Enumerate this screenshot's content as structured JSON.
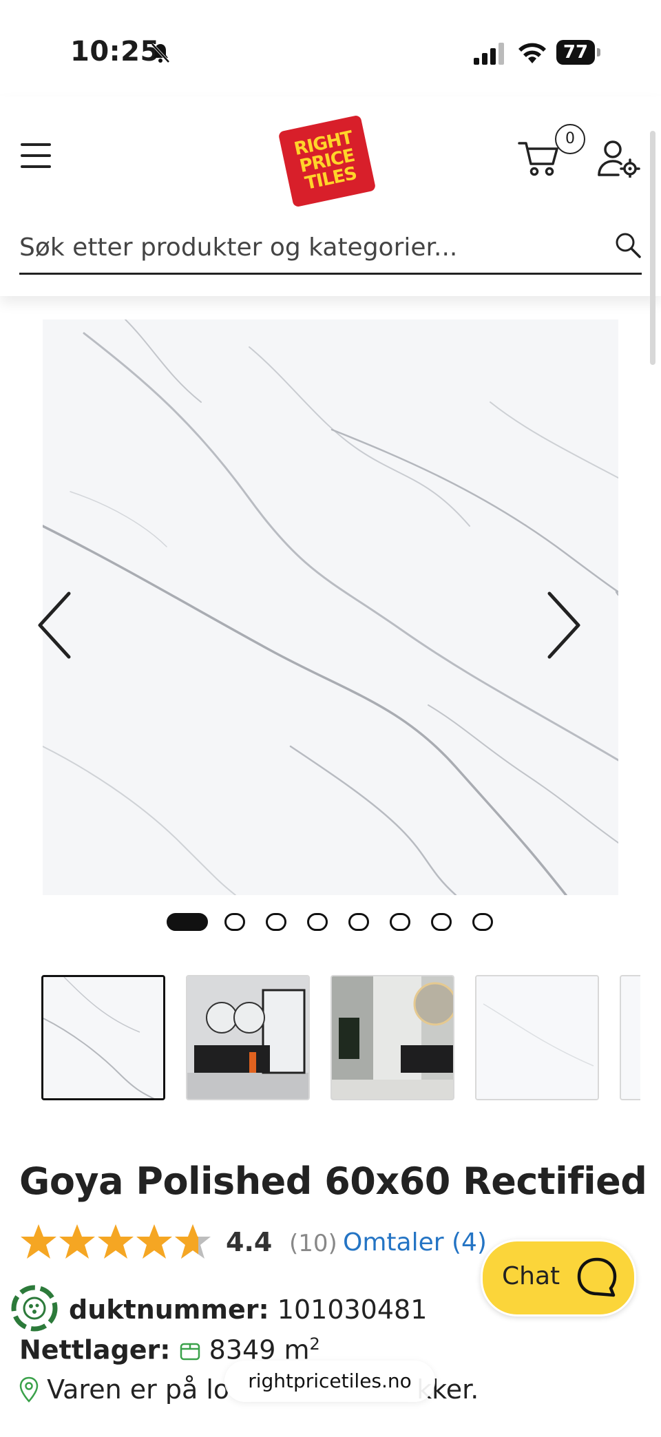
{
  "status_bar": {
    "time": "10:25",
    "battery": "77"
  },
  "header": {
    "logo_lines": [
      "RIGHT",
      "PRICE",
      "TILES"
    ],
    "cart_count": "0",
    "search_placeholder": "Søk etter produkter og kategorier..."
  },
  "gallery": {
    "image_count": 8,
    "active_index": 0,
    "thumbnails": [
      "white-marble",
      "bathroom-black-vanity",
      "bathroom-mirror",
      "white-marble",
      "white-marble"
    ]
  },
  "product": {
    "title": "Goya Polished 60x60 Rectified",
    "rating": "4.4",
    "rating_fraction": 0.88,
    "rating_count": "(10)",
    "reviews_link": "Omtaler (4)",
    "product_number_label": "duktnummer:",
    "product_number": "101030481",
    "stock_label": "Nettlager:",
    "stock_value": "8349 m",
    "stock_unit_sup": "2",
    "store_text_start": "Varen er på lo",
    "store_text_end": "kker."
  },
  "chat": {
    "label": "Chat"
  },
  "browser": {
    "url": "rightpricetiles.no"
  },
  "colors": {
    "accent": "#fbd53a",
    "link": "#2474c4",
    "star": "#f5a623",
    "logo_red": "#d81f2a"
  }
}
